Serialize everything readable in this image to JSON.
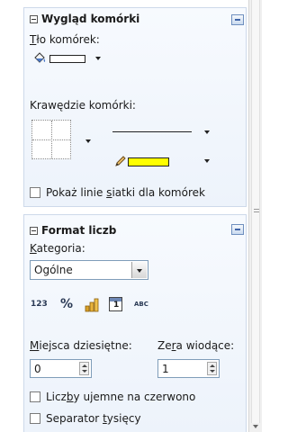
{
  "cell_appearance": {
    "title": "Wygląd komórki",
    "background": {
      "label_first": "T",
      "label_rest": "ło komórek:",
      "color": "#ffffff",
      "icon": "paint-bucket-icon"
    },
    "borders": {
      "label": "Krawędzie komórki:",
      "line_color": "#ffff00",
      "icon": "pencil-icon"
    },
    "gridlines_checkbox": {
      "label_before": "Pokaż linie ",
      "label_underlined": "s",
      "label_after": "iatki dla komórek",
      "checked": false
    }
  },
  "number_format": {
    "title": "Format liczb",
    "category": {
      "label_first": "K",
      "label_rest": "ategoria:",
      "value": "Ogólne"
    },
    "format_icons": [
      {
        "name": "number-format-icon",
        "text": "123"
      },
      {
        "name": "percent-format-icon",
        "text": "%"
      },
      {
        "name": "currency-format-icon",
        "text": ""
      },
      {
        "name": "date-format-icon",
        "text": "1"
      },
      {
        "name": "text-format-icon",
        "text": "ABC"
      }
    ],
    "decimal_places": {
      "label_first": "M",
      "label_rest": "iejsca dziesiętne:",
      "value": "0"
    },
    "leading_zeros": {
      "label_before": "Ze",
      "label_underlined": "r",
      "label_after": "a wiodące:",
      "value": "1"
    },
    "negative_red": {
      "label_before": "Licz",
      "label_underlined": "b",
      "label_after": "y ujemne na czerwono",
      "checked": false
    },
    "thousands_separator": {
      "label_before": "Separator ",
      "label_underlined": "t",
      "label_after": "ysięcy",
      "checked": false
    }
  },
  "colors": {
    "section_border": "#cdd9ea",
    "line_color_swatch": "#ffff00",
    "menu_button": "#3f64a8"
  }
}
